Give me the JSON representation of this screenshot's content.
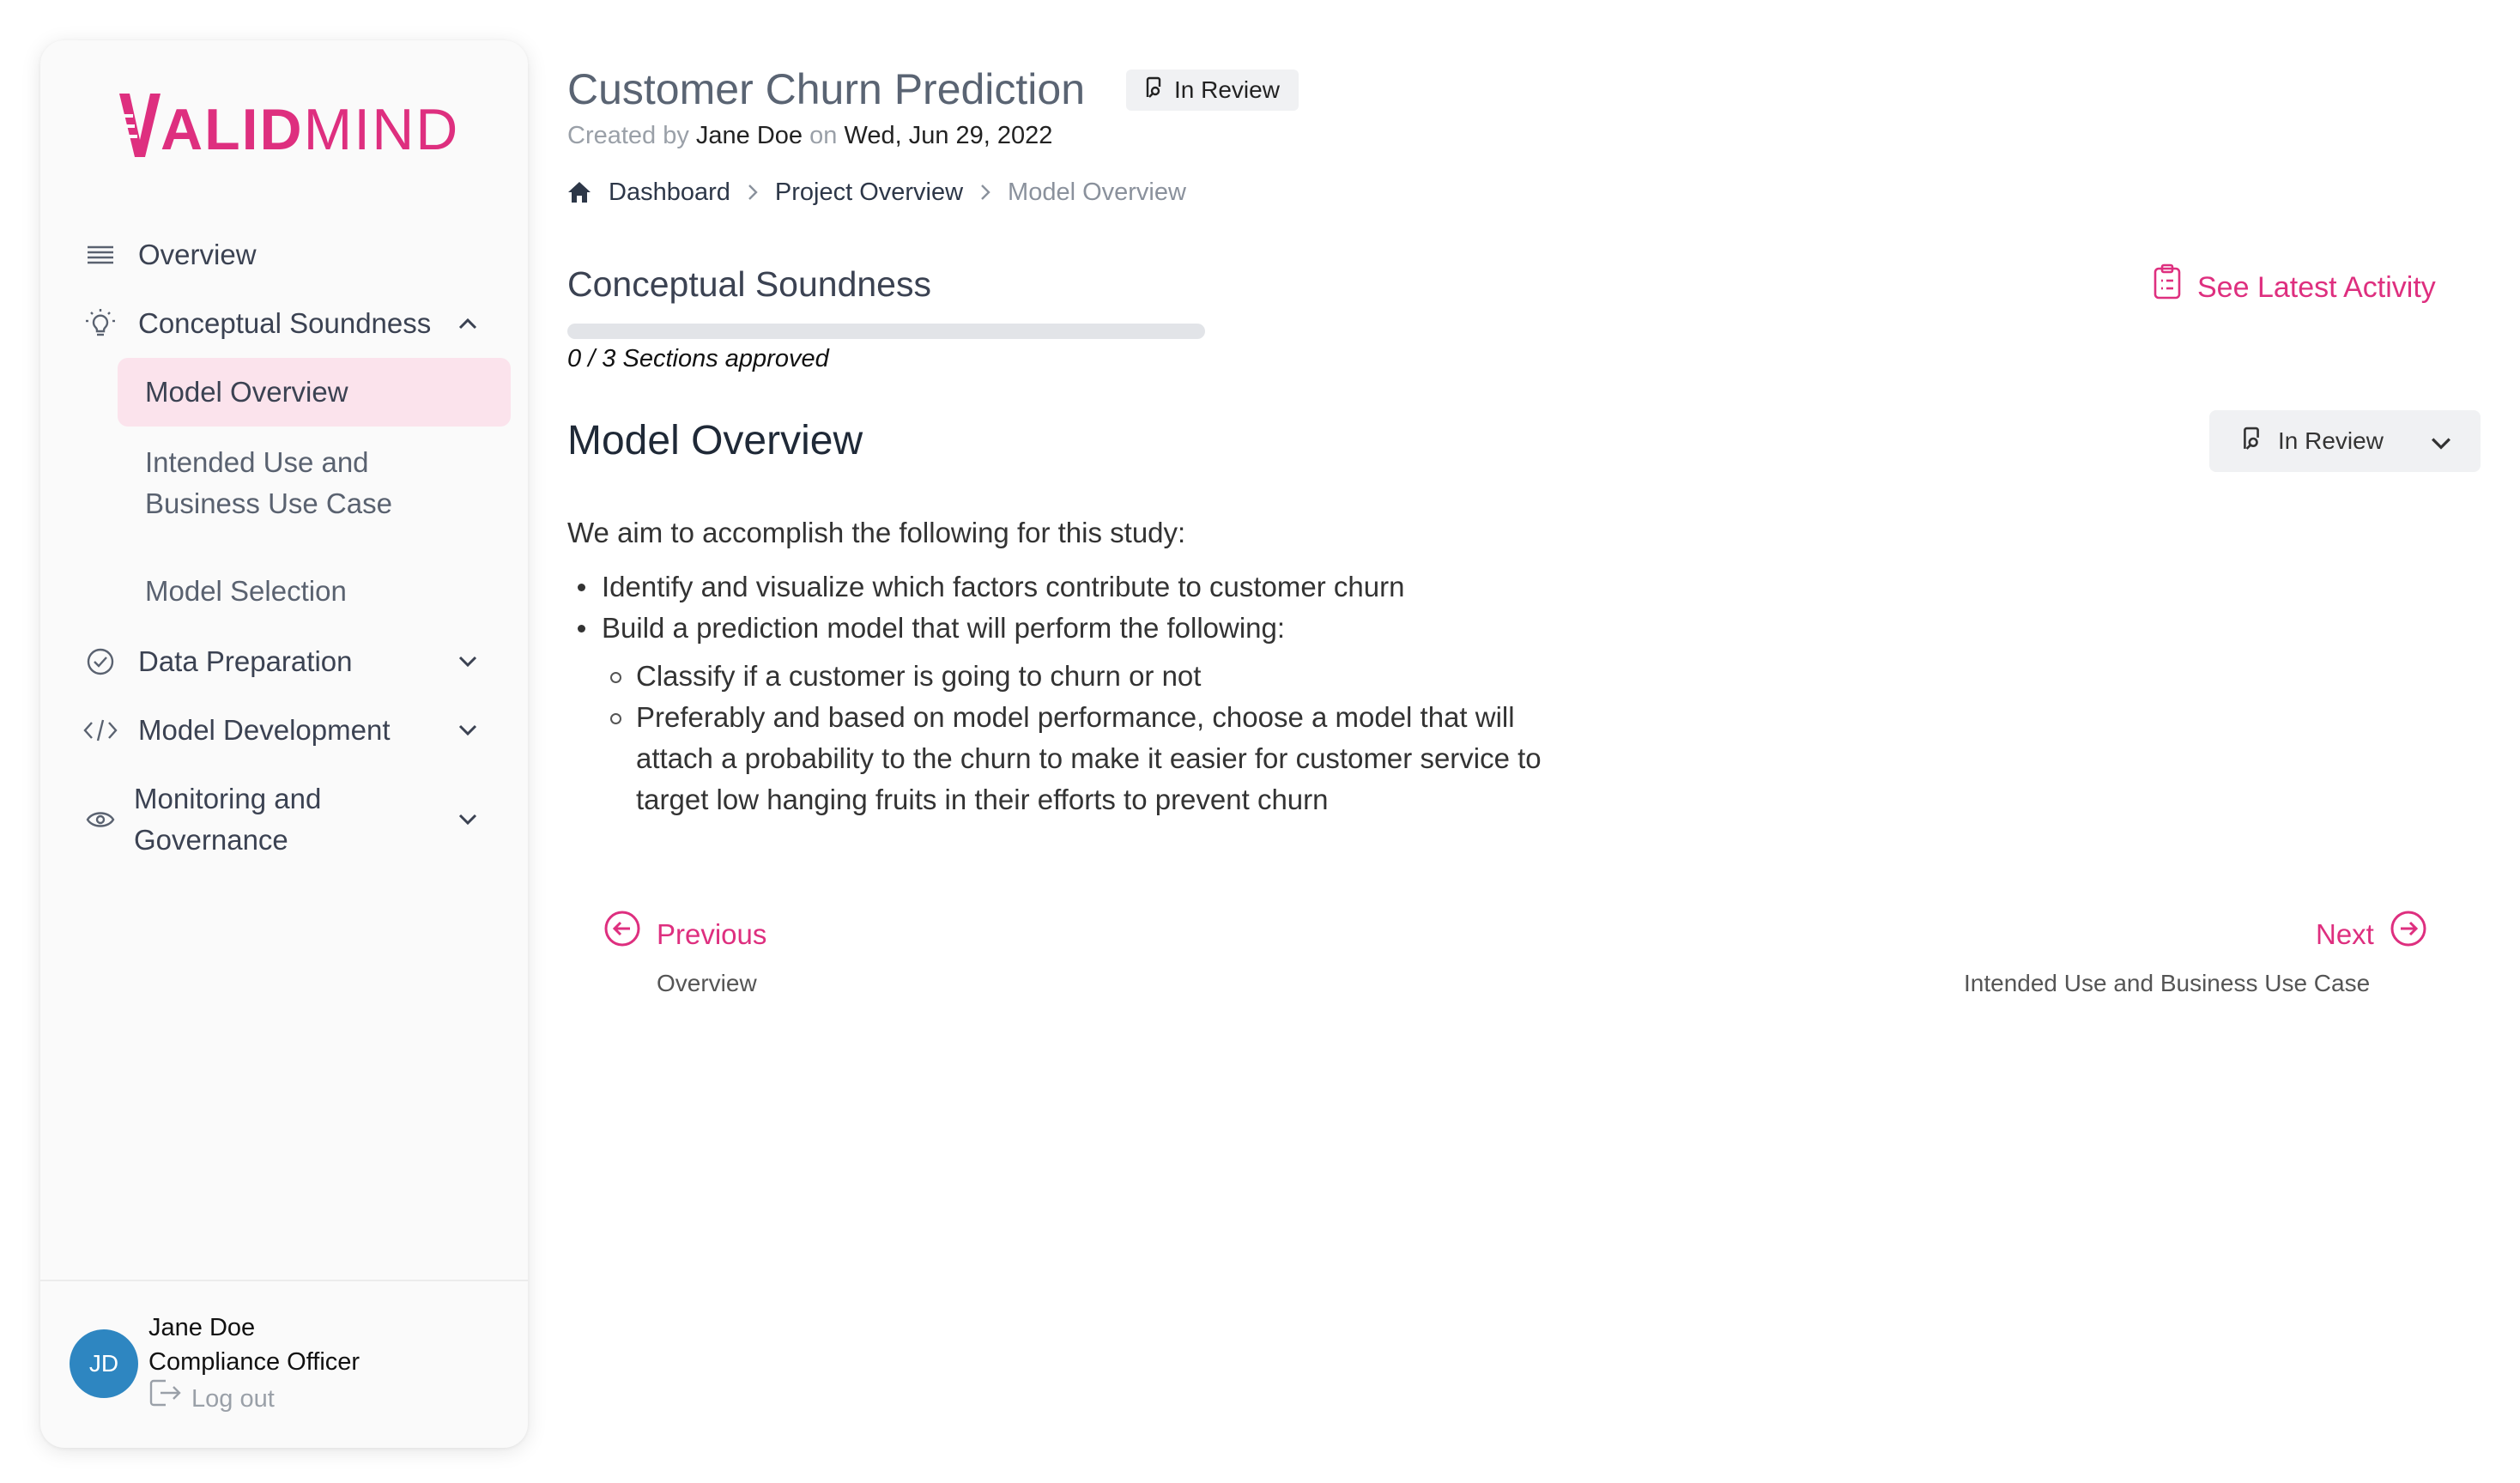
{
  "brand": {
    "name_bold": "VALID",
    "name_light": "MIND",
    "accent": "#de2f7f"
  },
  "sidebar": {
    "items": [
      {
        "label": "Overview",
        "icon": "list-icon"
      },
      {
        "label": "Conceptual Soundness",
        "icon": "lightbulb-icon",
        "expanded": true
      },
      {
        "label": "Data Preparation",
        "icon": "check-circle-icon"
      },
      {
        "label": "Model Development",
        "icon": "code-icon"
      },
      {
        "label": "Monitoring and Governance",
        "icon": "eye-icon"
      }
    ],
    "sub_items": [
      {
        "label": "Model Overview",
        "active": true
      },
      {
        "label": "Intended Use and Business Use Case"
      },
      {
        "label": "Model Selection"
      }
    ],
    "monitoring_line1": "Monitoring and",
    "monitoring_line2": "Governance",
    "intended_line1": "Intended Use and",
    "intended_line2": "Business Use Case"
  },
  "user": {
    "initials": "JD",
    "name": "Jane Doe",
    "role": "Compliance Officer",
    "logout": "Log out",
    "avatar_color": "#2e86c1"
  },
  "header": {
    "title": "Customer Churn Prediction",
    "status": "In Review",
    "created_prefix": "Created by",
    "created_by": "Jane Doe",
    "created_on_word": "on",
    "created_date": "Wed, Jun 29, 2022"
  },
  "breadcrumb": [
    "Dashboard",
    "Project Overview",
    "Model Overview"
  ],
  "section": {
    "title": "Conceptual Soundness",
    "progress_text": "0 / 3 Sections approved",
    "progress_fraction": 0,
    "see_activity": "See Latest Activity"
  },
  "content": {
    "title": "Model Overview",
    "status_dropdown": "In Review",
    "intro": "We aim to accomplish the following for this study:",
    "bullets": [
      "Identify and visualize which factors contribute to customer churn",
      "Build a prediction model that will perform the following:"
    ],
    "sub_bullets": [
      "Classify if a customer is going to churn or not",
      "Preferably and based on model performance, choose a model that will attach a probability to the churn to make it easier for customer service to target low hanging fruits in their efforts to prevent churn"
    ],
    "sub_bullet_lines": [
      "Preferably and based on model performance, choose a model that will",
      "attach a probability to the churn to make it easier for customer service to",
      "target low hanging fruits in their efforts to prevent churn"
    ]
  },
  "pager": {
    "prev_label": "Previous",
    "prev_target": "Overview",
    "next_label": "Next",
    "next_target": "Intended Use and Business Use Case"
  }
}
